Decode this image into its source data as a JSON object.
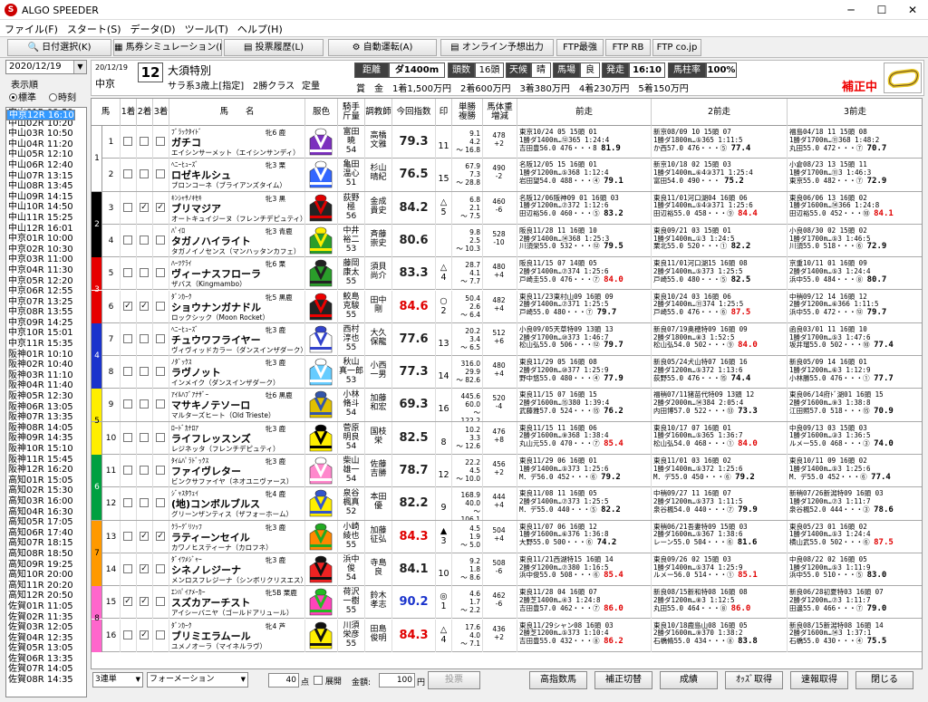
{
  "app": {
    "title": "ALGO SPEEDER"
  },
  "menu": [
    "ファイル(F)",
    "スタート(S)",
    "データ(D)",
    "ツール(T)",
    "ヘルプ(H)"
  ],
  "toolbar": [
    "日付選択(K)",
    "馬券シミュレーション(B)",
    "投票履歴(L)",
    "自動運転(A)",
    "オンライン予想出力",
    "FTP最強",
    "FTP RB",
    "FTP co.jp"
  ],
  "left": {
    "date": "2020/12/19",
    "display_order_label": "表示順",
    "opt_std": "標準",
    "opt_time": "時刻",
    "races": [
      "中山01R 09:50",
      "中山02R 10:20",
      "中山03R 10:50",
      "中山04R 11:20",
      "中山05R 12:10",
      "中山06R 12:40",
      "中山07R 13:15",
      "中山08R 13:45",
      "中山09R 14:15",
      "中山10R 14:50",
      "中山11R 15:25",
      "中山12R 16:01",
      "中京01R 10:00",
      "中京02R 10:30",
      "中京03R 11:00",
      "中京04R 11:30",
      "中京05R 12:20",
      "中京06R 12:55",
      "中京07R 13:25",
      "中京08R 13:55",
      "中京09R 14:25",
      "中京10R 15:01",
      "中京11R 15:35",
      "中京12R 16:10",
      "阪神01R 10:10",
      "阪神02R 10:40",
      "阪神03R 11:10",
      "阪神04R 11:40",
      "阪神05R 12:30",
      "阪神06R 13:05",
      "阪神07R 13:35",
      "阪神08R 14:05",
      "阪神09R 14:35",
      "阪神10R 15:10",
      "阪神11R 15:45",
      "阪神12R 16:20",
      "高知01R 15:05",
      "高知02R 15:30",
      "高知03R 16:00",
      "高知04R 16:30",
      "高知05R 17:05",
      "高知06R 17:40",
      "高知07R 18:15",
      "高知08R 18:50",
      "高知09R 19:25",
      "高知10R 20:00",
      "高知11R 20:20",
      "高知12R 20:50",
      "佐賀01R 11:05",
      "佐賀02R 11:35",
      "佐賀03R 12:05",
      "佐賀04R 12:35",
      "佐賀05R 13:05",
      "佐賀06R 13:35",
      "佐賀07R 14:05",
      "佐賀08R 14:35"
    ],
    "selected_index": 23
  },
  "race": {
    "date": "20/12/19",
    "venue": "中京",
    "num": "12",
    "name": "大須特別",
    "cond1": "サラ系3歳上[指定]",
    "cond2": "2勝クラス",
    "cond3": "定量",
    "dist_label": "距離",
    "dist": "ダ1400m",
    "heads_label": "頭数",
    "heads": "16頭",
    "weather_label": "天候",
    "weather": "晴",
    "track_label": "馬場",
    "track": "良",
    "post_label": "発走",
    "post": "16:10",
    "mhr_label": "馬柱率",
    "mhr": "100%",
    "prize": "賞　金　1着1,500万円　2着600万円　3着380万円　4着230万円　5着150万円",
    "correction": "補正中"
  },
  "columns": [
    "馬",
    "1着",
    "2着",
    "3着",
    "馬　　名",
    "服色",
    "騎手\n斤量",
    "調教師",
    "今回指数",
    "印",
    "単勝\n複勝",
    "馬体重\n増減",
    "前走",
    "2前走",
    "3前走"
  ],
  "horses": [
    {
      "wk": "1",
      "num": "1",
      "sire": "ﾌﾞﾗｯｸﾀｲﾄﾞ",
      "name": "ガチコ",
      "dam": "エイシンサーメット（エイシンサンディ）",
      "sa": "牝6 鹿",
      "jockey": "富田\n暁\n54",
      "trainer": "高橋\n文雅",
      "score": "79.3",
      "red": false,
      "mark": "",
      "pop": "11",
      "odds": "9.1\n4.2\n～ 16.8",
      "wt": "478\n+2",
      "p1": [
        "東京10/24 05 15頭 01",
        "1勝ダ1400m…⑫365 1:24:4",
        "吉田豊56.0 476・・・8 81.9"
      ],
      "p2": [
        "新京08/09 10 15頭 07",
        "1勝ダ1800m…⑤365 1:11:5",
        "か西57.0 476・・・⑤ 77.4"
      ],
      "p3": [
        "福島04/18 11 15頭 08",
        "1勝ダ1700m…⑪368 1:48:2",
        "丸田55.0 472・・・⑦ 70.7"
      ],
      "k": [
        0,
        0,
        0
      ]
    },
    {
      "wk": "1",
      "num": "2",
      "sire": "ﾍﾆｰﾋｭｰｽﾞ",
      "name": "ロゼキルシュ",
      "dam": "ブロンコーネ（ブライアンズタイム）",
      "sa": "牝3 栗",
      "jockey": "亀田\n温心\n51",
      "trainer": "杉山\n晴紀",
      "score": "76.5",
      "red": false,
      "mark": "",
      "pop": "15",
      "odds": "67.9\n7.3\n～ 28.8",
      "wt": "490\n-2",
      "p1": [
        "名阪12/05 15 16頭 01",
        "1勝ダ1200m…⑤368 1:12:4",
        "岩田望54.0 488・・・④ 79.1"
      ],
      "p2": [
        "新京10/18 02 15頭 03",
        "1勝ダ1400m…⑥4③371 1:25:4",
        "富田54.0 490・・・ 75.2"
      ],
      "p3": [
        "小倉08/23 13 15頭 11",
        "1勝ダ1700m…⑪3 1:46:3",
        "東京55.0 482・・・⑦ 72.9"
      ],
      "k": [
        0,
        0,
        0
      ]
    },
    {
      "wk": "2",
      "num": "3",
      "sire": "ｷﾝｼｬｻﾉｷｾｷ",
      "name": "ブリマジア",
      "dam": "オートキュイジーヌ（フレンチデピュティ）",
      "sa": "牝3 黒",
      "jockey": "荻野\n極\n56",
      "trainer": "金成\n貴史",
      "score": "84.2",
      "red": false,
      "mark": "△",
      "pop": "5",
      "odds": "6.8\n2.1\n～ 7.5",
      "wt": "460\n-6",
      "p1": [
        "名阪12/06阪神09 01 16頭 03",
        "1勝ダ1200m…⑦372 1:12:6",
        "田辺裕56.0 460・・・⑤ 83.2"
      ],
      "p2": [
        "東良11/01河口湖04 16頭 06",
        "1勝ダ1400m…⑤4③371 1:25:6",
        "田辺裕55.0 458・・・⑨ 84.4"
      ],
      "p3": [
        "東良06/06 13 16頭 02",
        "1勝ダ1600m…⑭366 1:24:8",
        "田辺裕55.0 452・・・⑩ 84.1"
      ],
      "k": [
        0,
        1,
        1
      ]
    },
    {
      "wk": "2",
      "num": "4",
      "sire": "ﾊﾟｲﾛ",
      "name": "タガノハイライト",
      "dam": "タガノイノセンス（マンハッタンカフェ）",
      "sa": "牝3 青鹿",
      "jockey": "中井\n裕二\n53",
      "trainer": "斉藤\n崇史",
      "score": "80.6",
      "red": false,
      "mark": "",
      "pop": "",
      "odds": "9.8\n2.5\n～ 10.3",
      "wt": "528\n-10",
      "p1": [
        "阪良11/28 11 16頭 10",
        "2勝ダ1400m…⑭368 1:25:3",
        "川須栄55.0 532・・・⑫ 79.5"
      ],
      "p2": [
        "東良09/21 03 15頭 01",
        "1勝ダ1400m…①3 1:24:5",
        "栗北55.0 520・・・① 82.2"
      ],
      "p3": [
        "小良08/30 02 15頭 02",
        "1勝ダ1700m…⑤3 1:46:5",
        "川須55.0 518・・・⑥ 72.9"
      ],
      "k": [
        0,
        0,
        0
      ]
    },
    {
      "wk": "3",
      "num": "5",
      "sire": "ﾊｰﾂｸﾗｲ",
      "name": "ヴィーナスフローラ",
      "dam": "ザバス（Kingmambo）",
      "sa": "牝6 栗",
      "jockey": "藤岡\n康太\n55",
      "trainer": "須貝\n尚介",
      "score": "83.3",
      "red": false,
      "mark": "△",
      "pop": "4",
      "odds": "28.7\n4.1\n～ 7.7",
      "wt": "480\n+4",
      "p1": [
        "阪良11/15 07 14頭 05",
        "2勝ダ1400m…⑦374 1:25:6",
        "戸崎圭55.0 476・・・⑦ 84.0"
      ],
      "p2": [
        "東良11/01河口湖15 16頭 08",
        "2勝ダ1400m…⑤373 1:25:5",
        "戸崎55.0 480・・・⑤ 82.5"
      ],
      "p3": [
        "京重10/11 01 16頭 09",
        "2勝ダ1400m…⑤3 1:24:4",
        "浜中55.0 484・・・⑧ 80.7"
      ],
      "k": [
        0,
        0,
        0
      ]
    },
    {
      "wk": "3",
      "num": "6",
      "sire": "ﾀﾞﾝｶｰｸ",
      "name": "ショウナンガナドル",
      "dam": "ロックシック（Moon Rocket）",
      "sa": "牝5 黒鹿",
      "jockey": "鮫島\n克駿\n55",
      "trainer": "田中\n剛",
      "score": "84.6",
      "red": true,
      "mark": "○",
      "pop": "2",
      "odds": "50.4\n2.6\n～ 6.4",
      "wt": "482\n+4",
      "p1": [
        "東良11/23東村山09 16頭 09",
        "2勝ダ1400m…⑦371 1:25:5",
        "戸崎55.0 480・・・⑦ 79.7"
      ],
      "p2": [
        "東良10/24 03 16頭 06",
        "2勝ダ1400m…⑪374 1:25:5",
        "戸崎55.0 476・・・⑥ 87.5"
      ],
      "p3": [
        "中稍09/12 14 16頭 12",
        "2勝ダ1200m…⑥366 1:11:5",
        "浜中55.0 472・・・⑫ 79.7"
      ],
      "k": [
        1,
        1,
        0
      ]
    },
    {
      "wk": "4",
      "num": "7",
      "sire": "ﾍﾆｰﾋｭｰｽﾞ",
      "name": "チュウワフライヤー",
      "dam": "ヴィヴィッドカラー（ダンスインザダーク）",
      "sa": "牝3 鹿",
      "jockey": "西村\n淳也\n55",
      "trainer": "大久\n保龍",
      "score": "77.6",
      "red": false,
      "mark": "",
      "pop": "13",
      "odds": "20.2\n3.4\n～ 6.5",
      "wt": "512\n+6",
      "p1": [
        "小良09/05天草特09 13頭 13",
        "2勝ダ1700m…⑩373 1:46:7",
        "松山弘55.0 506・・・⑫ 79.7"
      ],
      "p2": [
        "新良07/19奥穂特09 16頭 09",
        "2勝ダ1800m…⑧3 1:52:5",
        "松山弘54.0 502・・・⑨ 84.0"
      ],
      "p3": [
        "函良03/01 11 16頭 10",
        "1勝ダ1700m…⑤3 1:47:6",
        "坂井瑠55.0 502・・・⑩ 77.4"
      ],
      "k": [
        0,
        0,
        0
      ]
    },
    {
      "wk": "4",
      "num": "8",
      "sire": "ﾉﾀﾞｯｸｽ",
      "name": "ラヴノット",
      "dam": "インメイク（ダンスインザダーク）",
      "sa": "牝3 鹿",
      "jockey": "秋山\n真一郎\n53",
      "trainer": "小西\n一男",
      "score": "77.3",
      "red": false,
      "mark": "",
      "pop": "14",
      "odds": "316.0\n29.9\n～ 82.6",
      "wt": "480\n+4",
      "p1": [
        "東良11/29 05 16頭 08",
        "2勝ダ1200m…⑩377 1:25:9",
        "野中悠55.0 480・・・④ 77.9"
      ],
      "p2": [
        "新良05/24犬山特07 16頭 16",
        "2勝ダ1200m…⑤372 1:13:6",
        "荻野55.0 476・・・⑮ 74.4"
      ],
      "p3": [
        "新良05/09 14 16頭 01",
        "1勝ダ1200m…⑥3 1:12:9",
        "小林勝55.0 476・・・① 77.7"
      ],
      "k": [
        0,
        0,
        0
      ]
    },
    {
      "wk": "5",
      "num": "9",
      "sire": "ｱｲﾙﾊﾌﾞｱﾅｻﾞｰ",
      "name": "マサキノテソーロ",
      "dam": "マルターズヒート（Old Trieste）",
      "sa": "牡6 黒鹿",
      "jockey": "小林\n脩斗\n54",
      "trainer": "加藤\n和宏",
      "score": "69.3",
      "red": false,
      "mark": "",
      "pop": "16",
      "odds": "445.6\n60.0\n～ 122.2",
      "wt": "520\n-4",
      "p1": [
        "東良11/15 07 16頭 15",
        "2勝ダ1600m…⑮380 1:39:4",
        "武藤雅57.0 524・・・⑮ 76.2"
      ],
      "p2": [
        "福稍07/11猪苗代特09 13頭 12",
        "2勝ダ2000m…⑭384 2:05:4",
        "内田博57.0 522・・・⑬ 73.3"
      ],
      "p3": [
        "東良06/14府ﾄﾞ湖01 16頭 15",
        "2勝ダ1600m…⑨3 1:38:8",
        "江田照57.0 518・・・⑮ 70.9"
      ],
      "k": [
        0,
        0,
        0
      ]
    },
    {
      "wk": "5",
      "num": "10",
      "sire": "ﾛｰﾄﾞｶﾅﾛｱ",
      "name": "ライフレッスンズ",
      "dam": "レジネッタ（フレンチデピュティ）",
      "sa": "牝3 鹿",
      "jockey": "菅原\n明良\n54",
      "trainer": "国枝\n栄",
      "score": "82.5",
      "red": false,
      "mark": "",
      "pop": "8",
      "odds": "10.2\n3.3\n～ 12.6",
      "wt": "476\n+8",
      "p1": [
        "東良11/15 11 16頭 06",
        "2勝ダ1600m…⑨368 1:38:4",
        "丸山元55.0 470・・・⑦ 85.4"
      ],
      "p2": [
        "東良10/17 07 16頭 01",
        "1勝ダ1600m…⑤365 1:36:7",
        "松山弘54.0 468・・・① 84.0"
      ],
      "p3": [
        "中良09/13 03 15頭 03",
        "1勝ダ1600m…③3 1:36:5",
        "ルメー55.0 468・・・③ 74.0"
      ],
      "k": [
        0,
        0,
        0
      ]
    },
    {
      "wk": "6",
      "num": "11",
      "sire": "ﾀｲﾑﾊﾟﾗﾄﾞｯｸｽ",
      "name": "ファイヴレター",
      "dam": "ビンクサファイヤ（ネオユニヴァース）",
      "sa": "牝3 鹿",
      "jockey": "柴山\n雄一\n54",
      "trainer": "佐藤\n吉勝",
      "score": "78.7",
      "red": false,
      "mark": "",
      "pop": "12",
      "odds": "22.2\n4.5\n～ 10.0",
      "wt": "456\n+2",
      "p1": [
        "東良11/29 06 16頭 01",
        "1勝ダ1400m…⑤373 1:25:6",
        "M．デ56.0 452・・・⑥ 79.2"
      ],
      "p2": [
        "東良11/01 03 16頭 02",
        "1勝ダ1400m…⑤372 1:25:6",
        "M．デ55.0 450・・・⑥ 79.2"
      ],
      "p3": [
        "東良10/11 09 16頭 02",
        "1勝ダ1400m…⑤3 1:25:6",
        "M．デ55.0 452・・・⑥ 77.4"
      ],
      "k": [
        0,
        0,
        0
      ]
    },
    {
      "wk": "6",
      "num": "12",
      "sire": "ｼﾞｬｽﾀｳｪｲ",
      "name": "(地)コンボルブルス",
      "dam": "グリーンザンティス（ザフォーホーム）",
      "sa": "牝4 鹿",
      "jockey": "泉谷\n楓真\n52",
      "trainer": "本田\n優",
      "score": "82.2",
      "red": false,
      "mark": "",
      "pop": "9",
      "odds": "168.9\n40.0\n～ 106.1",
      "wt": "444\n+4",
      "p1": [
        "東良11/08 11 16頭 05",
        "2勝ダ1400m…⑦373 1:25:5",
        "M．デ55.0 440・・・⑤ 82.2"
      ],
      "p2": [
        "中稍09/27 11 16頭 07",
        "2勝ダ1200m…⑤373 1:11:5",
        "泉谷楓54.0 440・・・⑦ 79.9"
      ],
      "p3": [
        "新稍07/26新潟特09 16頭 03",
        "1勝ダ1200m…⑦3 1:11:7",
        "泉谷楓52.0 444・・・③ 78.6"
      ],
      "k": [
        0,
        0,
        0
      ]
    },
    {
      "wk": "7",
      "num": "13",
      "sire": "ｸﾗｰｸﾞﾘｿｯﾌ",
      "name": "ラティーンセイル",
      "dam": "カワノヒスティーナ（カロフネ）",
      "sa": "牝3 鹿",
      "jockey": "小崎\n綾也\n55",
      "trainer": "加藤\n征弘",
      "score": "84.3",
      "red": true,
      "mark": "▲",
      "pop": "3",
      "odds": "4.5\n1.9\n～ 5.0",
      "wt": "504\n+4",
      "p1": [
        "東良11/07 06 16頭 12",
        "1勝ダ1600m…⑥376 1:36:8",
        "大野55.0 500・・・⑥ 74.2"
      ],
      "p2": [
        "東稍06/21吾妻特09 15頭 03",
        "2勝ダ1600m…⑤367 1:38:6",
        "レーン55.0 504・・・⑥ 81.6"
      ],
      "p3": [
        "東良05/23 01 16頭 02",
        "1勝ダ1400m…⑤3 1:24:4",
        "横山武55.0 502・・・⑥ 87.5"
      ],
      "k": [
        0,
        1,
        1
      ]
    },
    {
      "wk": "7",
      "num": "14",
      "sire": "ﾀﾞｲﾜﾒｼﾞｬｰ",
      "name": "シネノレジーナ",
      "dam": "メンロスフレジーナ（シンボリクリスエス）",
      "sa": "牝3 鹿",
      "jockey": "浜中\n俊\n54",
      "trainer": "寺島\n良",
      "score": "84.1",
      "red": false,
      "mark": "",
      "pop": "10",
      "odds": "9.2\n1.8\n～ 8.6",
      "wt": "508\n-6",
      "p1": [
        "東良11/21西湖特15 16頭 14",
        "2勝ダ1200m…⑦380 1:16:5",
        "浜中俊55.0 508・・・⑥ 85.4"
      ],
      "p2": [
        "東良09/26 02 15頭 03",
        "1勝ダ1400m…⑤374 1:25:9",
        "ルメー56.0 514・・・① 85.1"
      ],
      "p3": [
        "中良08/22 02 16頭 05",
        "1勝ダ1200m…⑤3 1:11:9",
        "浜中55.0 510・・・⑤ 83.0"
      ],
      "k": [
        0,
        1,
        0
      ]
    },
    {
      "wk": "8",
      "num": "15",
      "sire": "ｴﾝﾊﾟｲｱﾒｰｶｰ",
      "name": "スズカアーチスト",
      "dam": "アイシーバニヤ（ゴールドアリュール）",
      "sa": "牝5B 栗鹿",
      "jockey": "荷沢\n一樹\n55",
      "trainer": "鈴木\n孝志",
      "score": "90.2",
      "red": false,
      "blue": true,
      "mark": "◎",
      "pop": "1",
      "odds": "4.6\n1.7\n～ 2.2",
      "wt": "462\n-6",
      "p1": [
        "東良11/28 04 16頭 07",
        "2勝芝1400m…④3 1:24:8",
        "吉田豊57.0 462・・・⑦ 86.0"
      ],
      "p2": [
        "新良08/15新和特08 16頭 08",
        "2勝ダ1200m…⑧3 1:12:5",
        "丸田55.0 464・・・⑧ 86.0"
      ],
      "p3": [
        "新良06/28初夏特03 16頭 07",
        "2勝ダ1200m…⑦3 1:11:7",
        "田邊55.0 466・・・⑦ 79.0"
      ],
      "k": [
        1,
        1,
        0
      ]
    },
    {
      "wk": "8",
      "num": "16",
      "sire": "ﾀﾞﾝｶｰｸ",
      "name": "ブリミエラムール",
      "dam": "ユメノオーラ（マイネルラヴ）",
      "sa": "牝4 芦",
      "jockey": "川須\n栄彦\n55",
      "trainer": "田島\n俊明",
      "score": "84.3",
      "red": true,
      "mark": "△",
      "pop": "4",
      "odds": "17.6\n4.0\n～ 7.1",
      "wt": "436\n+2",
      "p1": [
        "東良11/29シャン08 16頭 03",
        "2勝芝1200m…⑤373 1:10:4",
        "吉田豊55.0 432・・・⑧ 86.2"
      ],
      "p2": [
        "東良10/18鹿島山08 16頭 05",
        "2勝ダ1600m…⑨370 1:38:2",
        "石橋脩55.0 434・・・⑧ 83.8"
      ],
      "p3": [
        "新良08/15新潟特08 16頭 14",
        "2勝ダ1600m…⑭3 1:37:1",
        "石橋55.0 430・・・④ 75.5"
      ],
      "k": [
        0,
        1,
        0
      ]
    }
  ],
  "bottom": {
    "bet": "3連単",
    "form": "フォーメーション",
    "pts": "40",
    "pts_unit": "点",
    "spread": "展開",
    "amount_label": "金額:",
    "amount": "100",
    "yen": "円",
    "vote": "投票",
    "btns": [
      "高指数馬",
      "補正切替",
      "成績",
      "ｵｯｽﾞ取得",
      "速報取得",
      "閉じる"
    ]
  },
  "frame_colors": [
    "#ffffff",
    "#000000",
    "#e60000",
    "#1a33cc",
    "#ffee00",
    "#00a040",
    "#ff9900",
    "#ff66cc"
  ]
}
